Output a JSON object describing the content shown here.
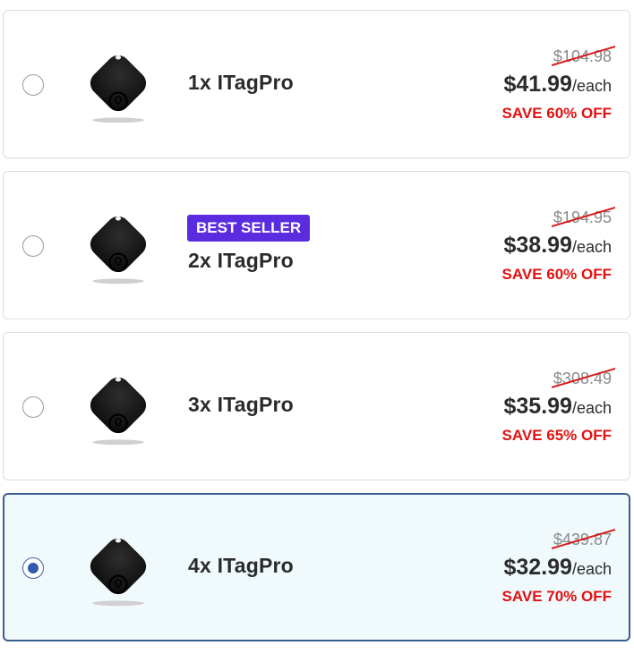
{
  "options": [
    {
      "name": "1x ITagPro",
      "old_price": "$104.98",
      "price": "$41.99",
      "unit": "/each",
      "save": "SAVE 60% OFF",
      "badge": "",
      "selected": false
    },
    {
      "name": "2x ITagPro",
      "old_price": "$194.95",
      "price": "$38.99",
      "unit": "/each",
      "save": "SAVE 60% OFF",
      "badge": "BEST SELLER",
      "selected": false
    },
    {
      "name": "3x ITagPro",
      "old_price": "$308.49",
      "price": "$35.99",
      "unit": "/each",
      "save": "SAVE 65% OFF",
      "badge": "",
      "selected": false
    },
    {
      "name": "4x ITagPro",
      "old_price": "$439.87",
      "price": "$32.99",
      "unit": "/each",
      "save": "SAVE 70% OFF",
      "badge": "",
      "selected": true
    }
  ],
  "colors": {
    "selected_border": "#3a5f8f",
    "selected_background": "#f0f9fc",
    "badge_background": "#5b2be0",
    "save_text": "#e31010",
    "strike_line": "#d81818"
  },
  "icons": {
    "product": "tracker-tag-icon"
  }
}
